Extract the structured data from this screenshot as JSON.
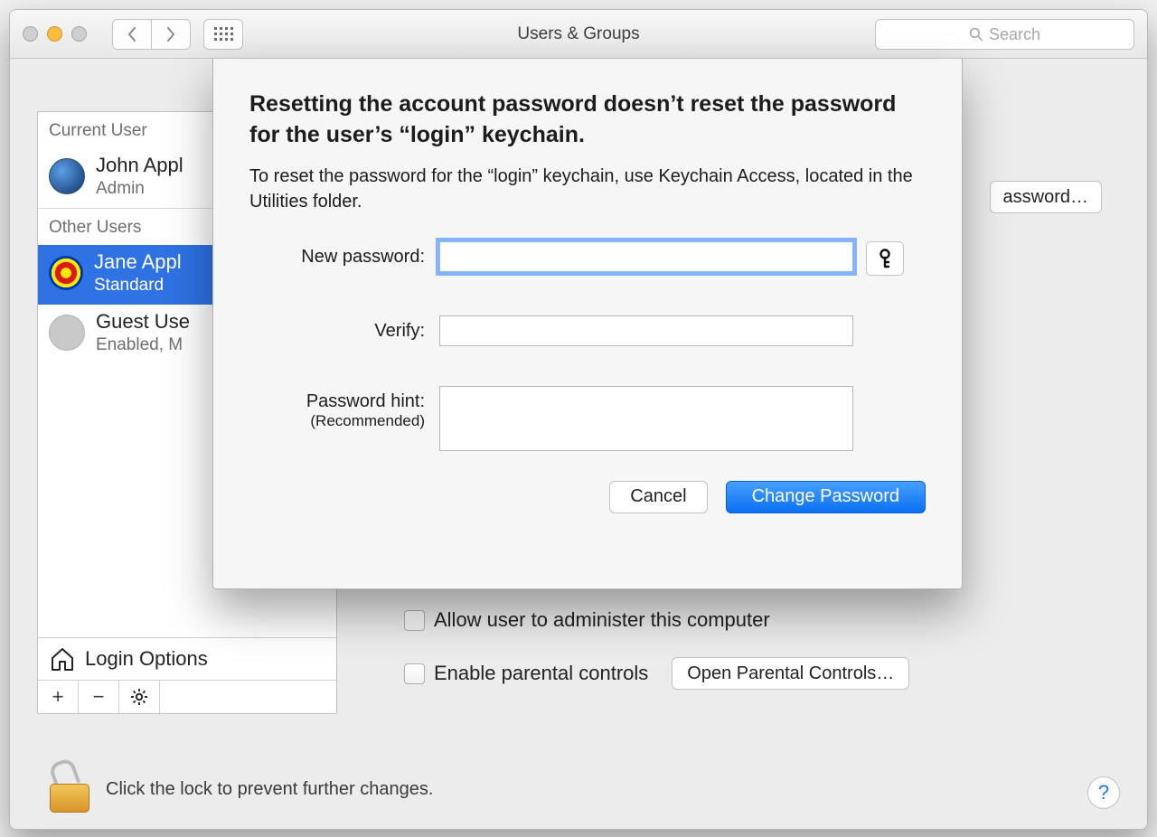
{
  "window": {
    "title": "Users & Groups",
    "search_placeholder": "Search"
  },
  "sidebar": {
    "current_header": "Current User",
    "other_header": "Other Users",
    "users": [
      {
        "name": "John Appl",
        "role": "Admin"
      },
      {
        "name": "Jane Appl",
        "role": "Standard"
      },
      {
        "name": "Guest Use",
        "role": "Enabled, M"
      }
    ],
    "login_options": "Login Options"
  },
  "panel": {
    "reset_button": "assword…",
    "allow_admin": "Allow user to administer this computer",
    "enable_parental": "Enable parental controls",
    "open_parental": "Open Parental Controls…"
  },
  "sheet": {
    "heading": "Resetting the account password doesn’t reset the password for the user’s “login” keychain.",
    "subtext": "To reset the password for the “login” keychain, use Keychain Access, located in the Utilities folder.",
    "labels": {
      "new_password": "New password:",
      "verify": "Verify:",
      "hint": "Password hint:",
      "hint_reco": "(Recommended)"
    },
    "values": {
      "new_password": "",
      "verify": "",
      "hint": ""
    },
    "buttons": {
      "cancel": "Cancel",
      "change": "Change Password"
    }
  },
  "footer": {
    "lock_text": "Click the lock to prevent further changes.",
    "help_glyph": "?"
  }
}
